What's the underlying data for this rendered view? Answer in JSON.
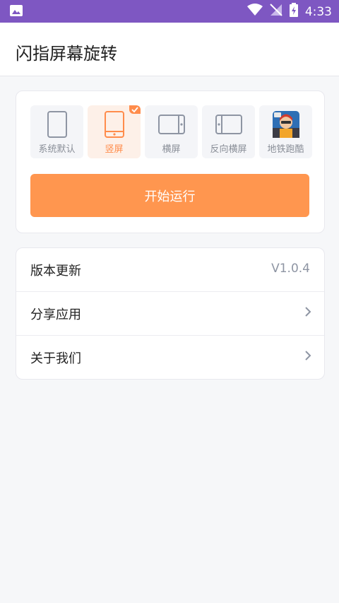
{
  "status_bar": {
    "time": "4:33"
  },
  "app_bar": {
    "title": "闪指屏幕旋转"
  },
  "modes": [
    {
      "label": "系统默认",
      "icon": "phone-outline-icon"
    },
    {
      "label": "竖屏",
      "icon": "portrait-icon",
      "selected": true
    },
    {
      "label": "横屏",
      "icon": "landscape-icon"
    },
    {
      "label": "反向横屏",
      "icon": "reverse-landscape-icon"
    },
    {
      "label": "地铁跑酷",
      "icon": "subway-surfers-app-icon"
    }
  ],
  "start_button": {
    "label": "开始运行"
  },
  "menu": {
    "version": {
      "label": "版本更新",
      "value": "V1.0.4"
    },
    "share": {
      "label": "分享应用"
    },
    "about": {
      "label": "关于我们"
    }
  },
  "colors": {
    "status_bar": "#7e57c2",
    "accent": "#ff964f",
    "background": "#f6f7f9"
  }
}
